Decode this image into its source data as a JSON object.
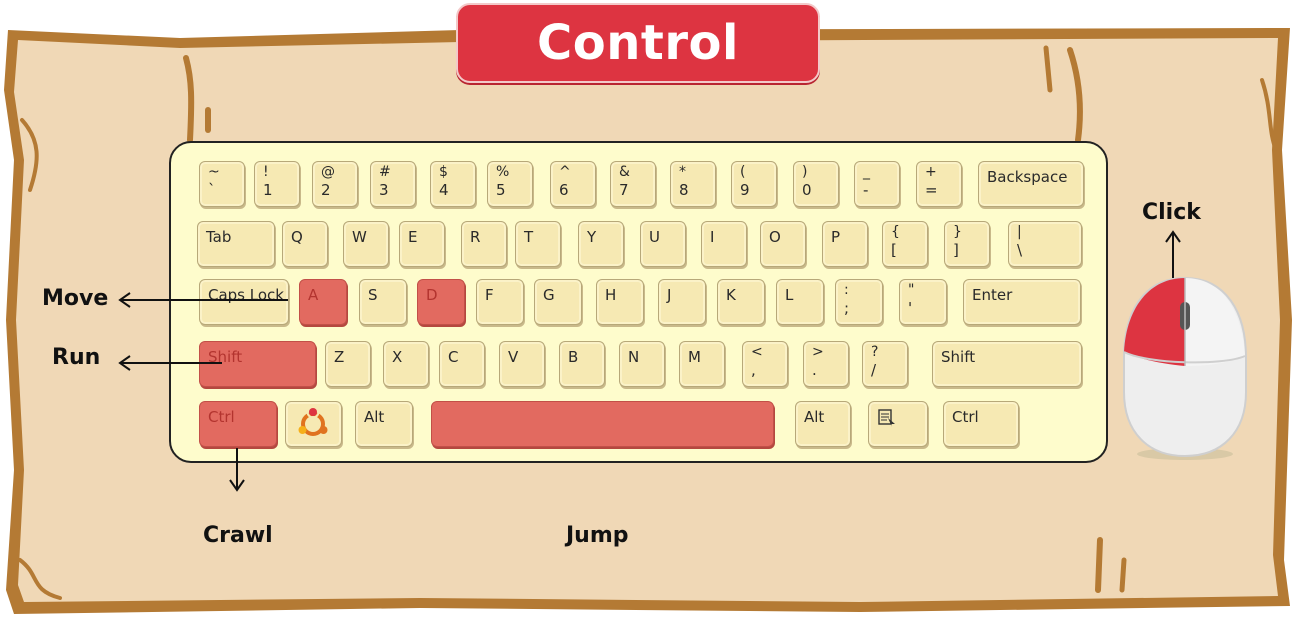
{
  "title": "Control",
  "colors": {
    "board": "#f0d8b6",
    "board_edge": "#b47a34",
    "banner": "#dd3441",
    "keyboard_bg": "#fefccc",
    "key": "#f6e9b3",
    "key_highlight": "#e26a60",
    "mouse_button_highlight": "#dd3441"
  },
  "keyboard": {
    "rows": [
      [
        {
          "id": "tilde",
          "top": "~",
          "bottom": "`"
        },
        {
          "id": "1",
          "top": "!",
          "bottom": "1"
        },
        {
          "id": "2",
          "top": "@",
          "bottom": "2"
        },
        {
          "id": "3",
          "top": "#",
          "bottom": "3"
        },
        {
          "id": "4",
          "top": "$",
          "bottom": "4"
        },
        {
          "id": "5",
          "top": "%",
          "bottom": "5"
        },
        {
          "id": "6",
          "top": "^",
          "bottom": "6"
        },
        {
          "id": "7",
          "top": "&",
          "bottom": "7"
        },
        {
          "id": "8",
          "top": "*",
          "bottom": "8"
        },
        {
          "id": "9",
          "top": "(",
          "bottom": "9"
        },
        {
          "id": "0",
          "top": ")",
          "bottom": "0"
        },
        {
          "id": "minus",
          "top": "_",
          "bottom": "-"
        },
        {
          "id": "equals",
          "top": "+",
          "bottom": "="
        },
        {
          "id": "backspace",
          "label": "Backspace"
        }
      ],
      [
        {
          "id": "tab",
          "label": "Tab"
        },
        {
          "id": "q",
          "label": "Q"
        },
        {
          "id": "w",
          "label": "W"
        },
        {
          "id": "e",
          "label": "E"
        },
        {
          "id": "r",
          "label": "R"
        },
        {
          "id": "t",
          "label": "T"
        },
        {
          "id": "y",
          "label": "Y"
        },
        {
          "id": "u",
          "label": "U"
        },
        {
          "id": "i",
          "label": "I"
        },
        {
          "id": "o",
          "label": "O"
        },
        {
          "id": "p",
          "label": "P"
        },
        {
          "id": "lbracket",
          "top": "{",
          "bottom": "["
        },
        {
          "id": "rbracket",
          "top": "}",
          "bottom": "]"
        },
        {
          "id": "backslash",
          "top": "|",
          "bottom": "\\"
        }
      ],
      [
        {
          "id": "capslock",
          "label": "Caps Lock"
        },
        {
          "id": "a",
          "label": "A",
          "highlight": true
        },
        {
          "id": "s",
          "label": "S"
        },
        {
          "id": "d",
          "label": "D",
          "highlight": true
        },
        {
          "id": "f",
          "label": "F"
        },
        {
          "id": "g",
          "label": "G"
        },
        {
          "id": "h",
          "label": "H"
        },
        {
          "id": "j",
          "label": "J"
        },
        {
          "id": "k",
          "label": "K"
        },
        {
          "id": "l",
          "label": "L"
        },
        {
          "id": "semicolon",
          "top": ":",
          "bottom": ";"
        },
        {
          "id": "quote",
          "top": "\"",
          "bottom": "'"
        },
        {
          "id": "enter",
          "label": "Enter"
        }
      ],
      [
        {
          "id": "lshift",
          "label": "Shift",
          "highlight": true
        },
        {
          "id": "z",
          "label": "Z"
        },
        {
          "id": "x",
          "label": "X"
        },
        {
          "id": "c",
          "label": "C"
        },
        {
          "id": "v",
          "label": "V"
        },
        {
          "id": "b",
          "label": "B"
        },
        {
          "id": "n",
          "label": "N"
        },
        {
          "id": "m",
          "label": "M"
        },
        {
          "id": "comma",
          "top": "<",
          "bottom": ","
        },
        {
          "id": "period",
          "top": ">",
          "bottom": "."
        },
        {
          "id": "slash",
          "top": "?",
          "bottom": "/"
        },
        {
          "id": "rshift",
          "label": "Shift"
        }
      ],
      [
        {
          "id": "lctrl",
          "label": "Ctrl",
          "highlight": true
        },
        {
          "id": "super",
          "icon": "ubuntu-logo-icon"
        },
        {
          "id": "lalt",
          "label": "Alt"
        },
        {
          "id": "space",
          "label": "",
          "highlight": true
        },
        {
          "id": "ralt",
          "label": "Alt"
        },
        {
          "id": "menu",
          "icon": "context-menu-icon"
        },
        {
          "id": "rctrl",
          "label": "Ctrl"
        }
      ]
    ]
  },
  "callouts": {
    "move": "Move",
    "run": "Run",
    "crawl": "Crawl",
    "jump": "Jump",
    "click": "Click"
  },
  "mouse": {
    "highlighted_button": "left",
    "icon": "mouse-icon"
  }
}
